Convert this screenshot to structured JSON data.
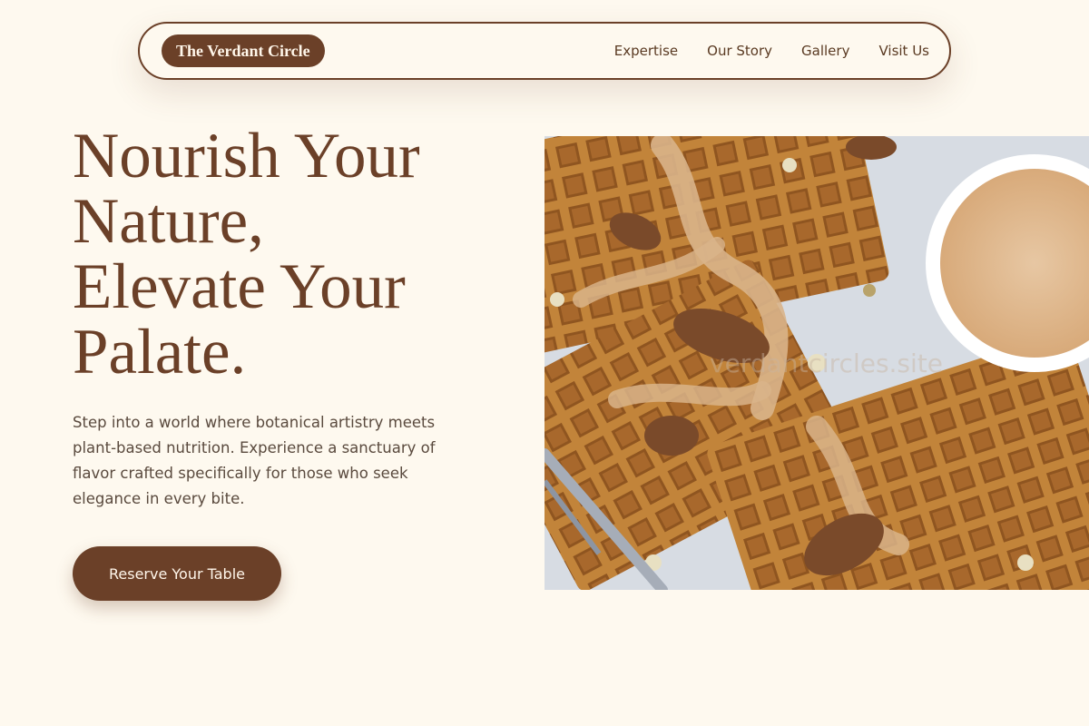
{
  "nav": {
    "brand": "The Verdant Circle",
    "links": [
      "Expertise",
      "Our Story",
      "Gallery",
      "Visit Us"
    ]
  },
  "hero": {
    "title_lines": [
      "Nourish Your",
      "Nature,",
      "Elevate Your",
      "Palate."
    ],
    "description": "Step into a world where botanical artistry meets plant-based nutrition. Experience a sanctuary of flavor crafted specifically for those who seek elegance in every bite.",
    "cta_label": "Reserve Your Table",
    "image_watermark": "verdantcircles.site"
  },
  "colors": {
    "background": "#fef9ef",
    "brand_brown": "#6b4028",
    "body_text": "#5a4a3e"
  }
}
